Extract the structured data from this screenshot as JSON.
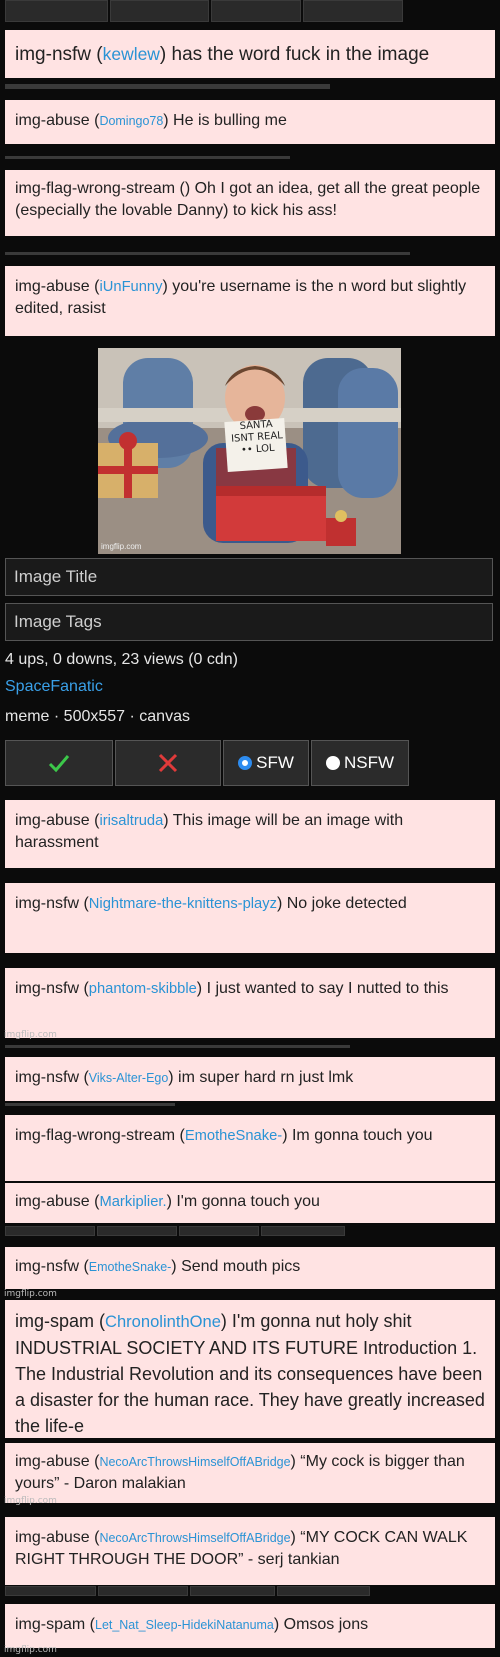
{
  "flags": [
    {
      "type": "img-nsfw",
      "user": "kewlew",
      "message": "has the word fuck in the image"
    },
    {
      "type": "img-abuse",
      "user": "Domingo78",
      "message": "He is bulling me"
    },
    {
      "type": "img-flag-wrong-stream",
      "user": "",
      "message": "Oh I got an idea, get all the great people (especially the lovable Danny) to kick his ass!"
    },
    {
      "type": "img-abuse",
      "user": "iUnFunny",
      "message": "you're username is the n word but slightly edited, rasist"
    },
    {
      "type": "img-abuse",
      "user": "irisaltruda",
      "message": "This image will be an image with harassment"
    },
    {
      "type": "img-nsfw",
      "user": "Nightmare-the-knittens-playz",
      "message": "No joke detected"
    },
    {
      "type": "img-nsfw",
      "user": "phantom-skibble",
      "message": "I just wanted to say I nutted to this"
    },
    {
      "type": "img-nsfw",
      "user": "Viks-Alter-Ego",
      "message": "im super hard rn just lmk"
    },
    {
      "type": "img-flag-wrong-stream",
      "user": "EmotheSnake-",
      "message": "Im gonna touch you"
    },
    {
      "type": "img-abuse",
      "user": "Markiplier.",
      "message": "I'm gonna touch you"
    },
    {
      "type": "img-nsfw",
      "user": "EmotheSnake-",
      "message": "Send mouth pics"
    },
    {
      "type": "img-spam",
      "user": "ChronolinthOne",
      "message": "I'm gonna nut holy shit INDUSTRIAL SOCIETY AND ITS FUTURE Introduction 1. The Industrial Revolution and its consequences have been a disaster for the human race. They have greatly increased the life-e"
    },
    {
      "type": "img-abuse",
      "user": "NecoArcThrowsHimselfOffABridge",
      "message": "“My cock is bigger than yours” - Daron malakian"
    },
    {
      "type": "img-abuse",
      "user": "NecoArcThrowsHimselfOffABridge",
      "message": "“MY COCK CAN WALK RIGHT THROUGH THE DOOR” - serj tankian"
    },
    {
      "type": "img-spam",
      "user": "Let_Nat_Sleep-HidekiNatanuma",
      "message": "Omsos jons"
    }
  ],
  "image": {
    "sign_text": "SANTA ISNT REAL •• LOL",
    "watermark": "imgflip.com"
  },
  "fields": {
    "title_placeholder": "Image Title",
    "tags_placeholder": "Image Tags"
  },
  "stats": {
    "views_line": "4 ups, 0 downs, 23 views (0 cdn)",
    "author": "SpaceFanatic",
    "info": "meme · 500x557 · canvas"
  },
  "vote": {
    "approve_icon": "check-icon",
    "reject_icon": "x-icon",
    "sfw_label": "SFW",
    "nsfw_label": "NSFW",
    "colors": {
      "approve": "#3cc84a",
      "reject": "#e03a3a",
      "radio": "#2d8cf0"
    }
  },
  "watermarks": [
    "imgflip.com"
  ]
}
